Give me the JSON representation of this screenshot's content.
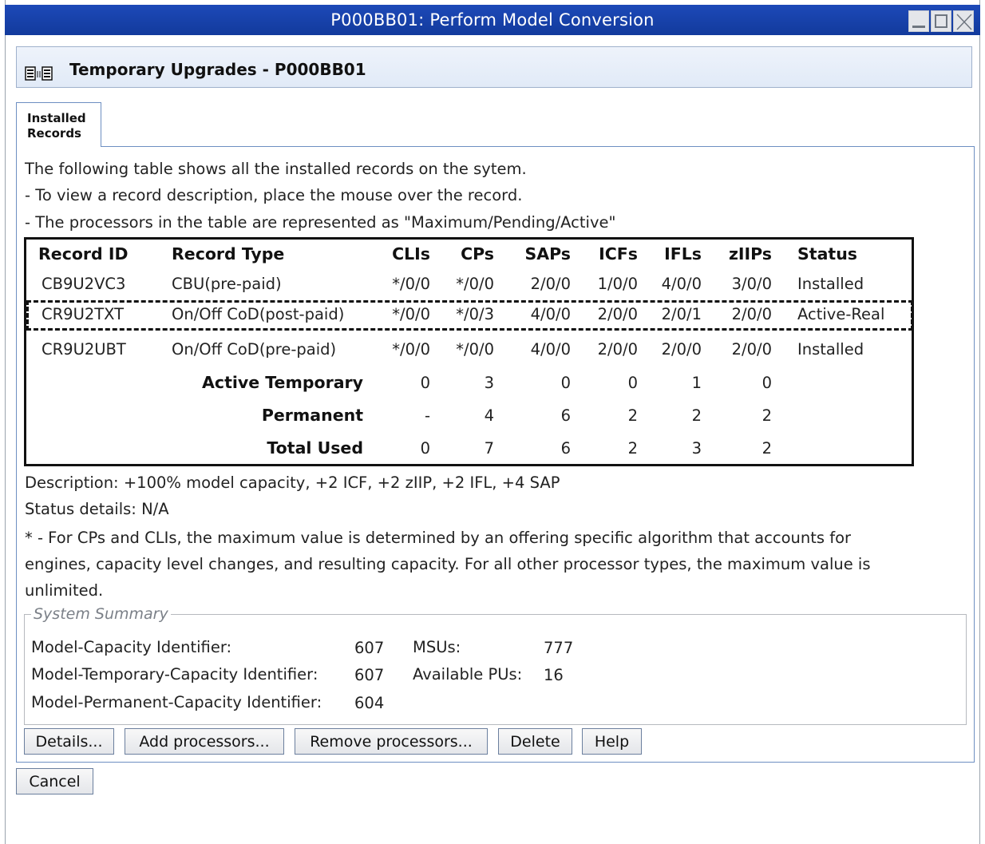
{
  "window": {
    "title": "P000BB01: Perform Model Conversion"
  },
  "header": {
    "title": "Temporary Upgrades - P000BB01"
  },
  "tab": {
    "line1": "Installed",
    "line2": "Records"
  },
  "intro": {
    "line1": "The following table shows all the installed records on the sytem.",
    "line2": "- To view a record description, place the mouse over the record.",
    "line3": "- The processors in the table are represented as \"Maximum/Pending/Active\""
  },
  "table": {
    "columns": [
      "Record ID",
      "Record Type",
      "CLIs",
      "CPs",
      "SAPs",
      "ICFs",
      "IFLs",
      "zIIPs",
      "Status"
    ],
    "rows": [
      [
        "CB9U2VC3",
        "CBU(pre-paid)",
        "*/0/0",
        "*/0/0",
        "2/0/0",
        "1/0/0",
        "4/0/0",
        "3/0/0",
        "Installed"
      ],
      [
        "CR9U2TXT",
        "On/Off CoD(post-paid)",
        "*/0/0",
        "*/0/3",
        "4/0/0",
        "2/0/0",
        "2/0/1",
        "2/0/0",
        "Active-Real"
      ],
      [
        "CR9U2UBT",
        "On/Off CoD(pre-paid)",
        "*/0/0",
        "*/0/0",
        "4/0/0",
        "2/0/0",
        "2/0/0",
        "2/0/0",
        "Installed"
      ]
    ],
    "selected_row": 1,
    "totals": [
      {
        "label": "Active Temporary",
        "values": [
          "0",
          "3",
          "0",
          "0",
          "1",
          "0"
        ]
      },
      {
        "label": "Permanent",
        "values": [
          "-",
          "4",
          "6",
          "2",
          "2",
          "2"
        ]
      },
      {
        "label": "Total Used",
        "values": [
          "0",
          "7",
          "6",
          "2",
          "3",
          "2"
        ]
      }
    ]
  },
  "description": "Description:  +100% model capacity, +2 ICF, +2 zIIP, +2 IFL, +4 SAP",
  "status_details": "Status details:  N/A",
  "footnote": {
    "line1": "* - For CPs and CLIs, the maximum value is determined by an offering specific algorithm that accounts for",
    "line2": "engines, capacity level changes, and resulting capacity. For all other processor types, the maximum value is",
    "line3": "unlimited."
  },
  "summary": {
    "legend": "System Summary",
    "model_capacity_label": "Model-Capacity Identifier:",
    "model_capacity_value": "607",
    "model_temp_label": "Model-Temporary-Capacity Identifier:",
    "model_temp_value": "607",
    "model_perm_label": "Model-Permanent-Capacity Identifier:",
    "model_perm_value": "604",
    "msus_label": "MSUs:",
    "msus_value": "777",
    "pus_label": "Available PUs:",
    "pus_value": "16"
  },
  "buttons": {
    "details": "Details...",
    "add": "Add processors...",
    "remove": "Remove processors...",
    "delete": "Delete",
    "help": "Help",
    "cancel": "Cancel"
  }
}
